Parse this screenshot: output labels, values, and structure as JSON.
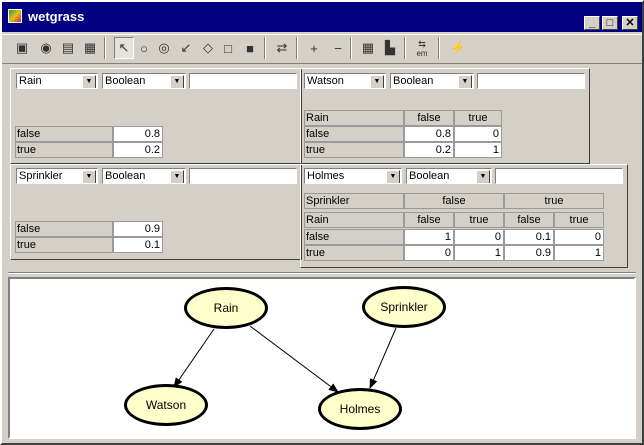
{
  "window": {
    "title": "wetgrass",
    "controls": {
      "minimize": "_",
      "maximize": "□",
      "close": "✕"
    }
  },
  "toolbar": {
    "tools": [
      {
        "name": "properties-icon",
        "glyph": "▣"
      },
      {
        "name": "compile-icon",
        "glyph": "◉"
      },
      {
        "name": "monitor-icon",
        "glyph": "▤"
      },
      {
        "name": "report-icon",
        "glyph": "▦"
      },
      {
        "name": "select-arrow-icon",
        "glyph": "↖"
      },
      {
        "name": "chance-node-icon",
        "glyph": "○"
      },
      {
        "name": "utility-node-icon",
        "glyph": "◎"
      },
      {
        "name": "link-arrow-icon",
        "glyph": "↙"
      },
      {
        "name": "decision-node-icon",
        "glyph": "◇"
      },
      {
        "name": "rectangle-node-icon",
        "glyph": "□"
      },
      {
        "name": "disabled-node-icon",
        "glyph": "■"
      },
      {
        "name": "layout-icon",
        "glyph": "⇄"
      },
      {
        "name": "zoom-in-icon",
        "glyph": "+"
      },
      {
        "name": "zoom-out-icon",
        "glyph": "−"
      },
      {
        "name": "table-icon",
        "glyph": "▦"
      },
      {
        "name": "chart-icon",
        "glyph": "▙"
      },
      {
        "name": "em-icon",
        "glyph": "⇆",
        "label": "em"
      },
      {
        "name": "lightning-icon",
        "glyph": "⚡"
      }
    ]
  },
  "panels": {
    "rain": {
      "node": "Rain",
      "type": "Boolean",
      "rows": [
        {
          "label": "false",
          "value": "0.8"
        },
        {
          "label": "true",
          "value": "0.2"
        }
      ]
    },
    "sprinkler": {
      "node": "Sprinkler",
      "type": "Boolean",
      "rows": [
        {
          "label": "false",
          "value": "0.9"
        },
        {
          "label": "true",
          "value": "0.1"
        }
      ]
    },
    "watson": {
      "node": "Watson",
      "type": "Boolean",
      "parent": "Rain",
      "cols": [
        "false",
        "true"
      ],
      "rows": [
        {
          "label": "false",
          "values": [
            "0.8",
            "0"
          ]
        },
        {
          "label": "true",
          "values": [
            "0.2",
            "1"
          ]
        }
      ]
    },
    "holmes": {
      "node": "Holmes",
      "type": "Boolean",
      "parents": [
        "Sprinkler",
        "Rain"
      ],
      "sprinkler_vals": [
        "false",
        "true"
      ],
      "rain_vals": [
        "false",
        "true",
        "false",
        "true"
      ],
      "rows": [
        {
          "label": "false",
          "values": [
            "1",
            "0",
            "0.1",
            "0"
          ]
        },
        {
          "label": "true",
          "values": [
            "0",
            "1",
            "0.9",
            "1"
          ]
        }
      ]
    }
  },
  "graph": {
    "nodes": {
      "rain": "Rain",
      "sprinkler": "Sprinkler",
      "watson": "Watson",
      "holmes": "Holmes"
    }
  }
}
